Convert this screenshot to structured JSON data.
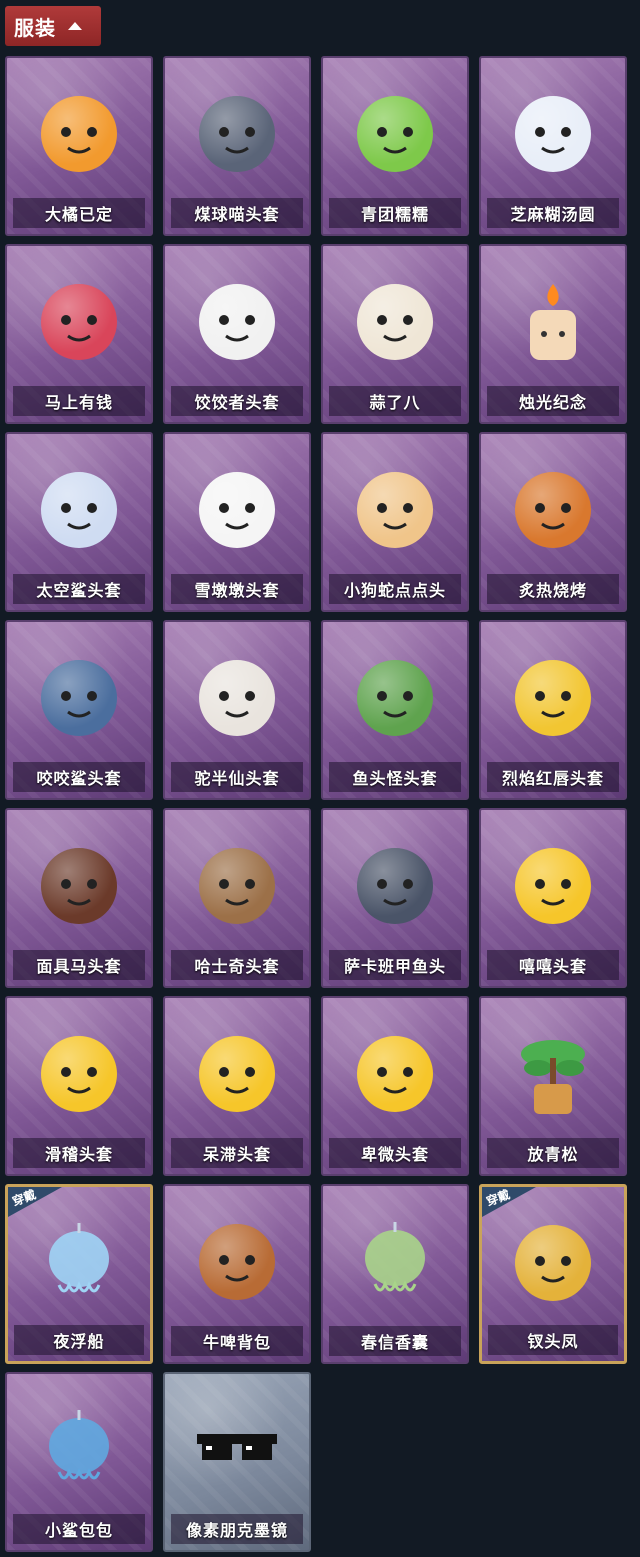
{
  "header": {
    "label": "服装"
  },
  "items": [
    {
      "name": "大橘已定",
      "icon": "orange-icon",
      "color": "#f29a2e",
      "style": "normal"
    },
    {
      "name": "煤球喵头套",
      "icon": "cat-head-icon",
      "color": "#5a6478",
      "style": "normal"
    },
    {
      "name": "青团糯糯",
      "icon": "green-rice-ball-icon",
      "color": "#7ec94a",
      "style": "normal"
    },
    {
      "name": "芝麻糊汤圆",
      "icon": "rice-dumpling-icon",
      "color": "#e8eef8",
      "style": "normal"
    },
    {
      "name": "马上有钱",
      "icon": "horse-head-icon",
      "color": "#d9455a",
      "style": "normal"
    },
    {
      "name": "饺饺者头套",
      "icon": "dumpling-head-icon",
      "color": "#f1f1f1",
      "style": "normal"
    },
    {
      "name": "蒜了八",
      "icon": "garlic-icon",
      "color": "#efe6d6",
      "style": "normal"
    },
    {
      "name": "烛光纪念",
      "icon": "candle-icon",
      "color": "#f4d9b8",
      "style": "normal"
    },
    {
      "name": "太空鲨头套",
      "icon": "space-shark-icon",
      "color": "#cfdcf2",
      "style": "normal"
    },
    {
      "name": "雪墩墩头套",
      "icon": "snowman-head-icon",
      "color": "#f5f5f5",
      "style": "normal"
    },
    {
      "name": "小狗蛇点点头",
      "icon": "snake-dog-icon",
      "color": "#f0c58a",
      "style": "normal"
    },
    {
      "name": "炙热烧烤",
      "icon": "bbq-block-icon",
      "color": "#d9782e",
      "style": "normal"
    },
    {
      "name": "咬咬鲨头套",
      "icon": "biting-shark-icon",
      "color": "#4b6e9e",
      "style": "normal"
    },
    {
      "name": "驼半仙头套",
      "icon": "sunglasses-bear-icon",
      "color": "#e9e4de",
      "style": "normal"
    },
    {
      "name": "鱼头怪头套",
      "icon": "fish-mask-icon",
      "color": "#5fa34e",
      "style": "normal"
    },
    {
      "name": "烈焰红唇头套",
      "icon": "yellow-mask-icon",
      "color": "#f2c632",
      "style": "normal"
    },
    {
      "name": "面具马头套",
      "icon": "horse-mask-icon",
      "color": "#6b3a2a",
      "style": "normal"
    },
    {
      "name": "哈士奇头套",
      "icon": "husky-head-icon",
      "color": "#9c7048",
      "style": "normal"
    },
    {
      "name": "萨卡班甲鱼头",
      "icon": "fish-head-icon",
      "color": "#4a5468",
      "style": "normal"
    },
    {
      "name": "嘻嘻头套",
      "icon": "grin-emoji-icon",
      "color": "#f6c62a",
      "style": "normal"
    },
    {
      "name": "滑稽头套",
      "icon": "smirk-emoji-icon",
      "color": "#f6c62a",
      "style": "normal"
    },
    {
      "name": "呆滞头套",
      "icon": "blank-emoji-icon",
      "color": "#f6c62a",
      "style": "normal"
    },
    {
      "name": "卑微头套",
      "icon": "shy-emoji-icon",
      "color": "#f6c62a",
      "style": "normal"
    },
    {
      "name": "放青松",
      "icon": "bonsai-pine-icon",
      "color": "#4caf50",
      "style": "normal"
    },
    {
      "name": "夜浮船",
      "icon": "jellyfish-icon",
      "color": "#9fd4f5",
      "style": "gold",
      "badge": "穿戴"
    },
    {
      "name": "牛啤背包",
      "icon": "beer-cow-backpack-icon",
      "color": "#b86b35",
      "style": "normal"
    },
    {
      "name": "春信香囊",
      "icon": "sachet-icon",
      "color": "#a8d48a",
      "style": "normal"
    },
    {
      "name": "钗头凤",
      "icon": "phoenix-crown-icon",
      "color": "#e4b23a",
      "style": "gold",
      "badge": "穿戴"
    },
    {
      "name": "小鲨包包",
      "icon": "shark-bag-icon",
      "color": "#5fa8e0",
      "style": "normal"
    },
    {
      "name": "像素朋克墨镜",
      "icon": "pixel-sunglasses-icon",
      "color": "#111111",
      "style": "silver"
    }
  ]
}
